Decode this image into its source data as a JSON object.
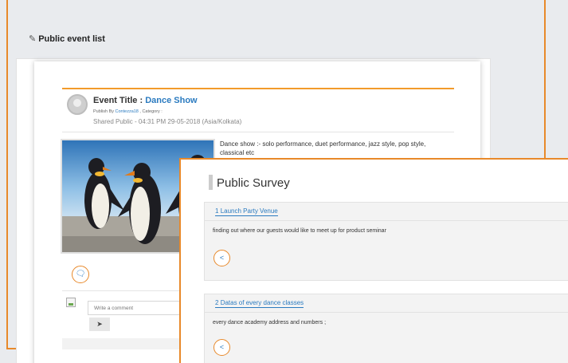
{
  "event_panel": {
    "title": "Public event list",
    "event": {
      "title_label": "Event Title : ",
      "title_value": "Dance Show",
      "publish_prefix": "Publish By ",
      "publisher": "Contezza18",
      "category_label": " , Category :",
      "shared": "Shared Public - 04:31 PM 29-05-2018 (Asia/Kolkata)",
      "description": "Dance show :- solo performance, duet performance, jazz style, pop style, classical etc"
    },
    "comment": {
      "placeholder": "Write a comment"
    }
  },
  "survey_panel": {
    "title": "Public Survey",
    "items": [
      {
        "number": "1",
        "title": "Launch Party Venue",
        "body": "finding out where our guests would like to meet up for product seminar"
      },
      {
        "number": "2",
        "title": "Datas of every dance classes",
        "body": "every dance academy address and numbers ;"
      }
    ]
  },
  "colors": {
    "accent": "#e8892a",
    "link": "#2b7bc0"
  },
  "icons": {
    "edit": "pencil-square-icon",
    "comment": "comment-icon",
    "send": "send-icon",
    "share": "share-icon"
  }
}
